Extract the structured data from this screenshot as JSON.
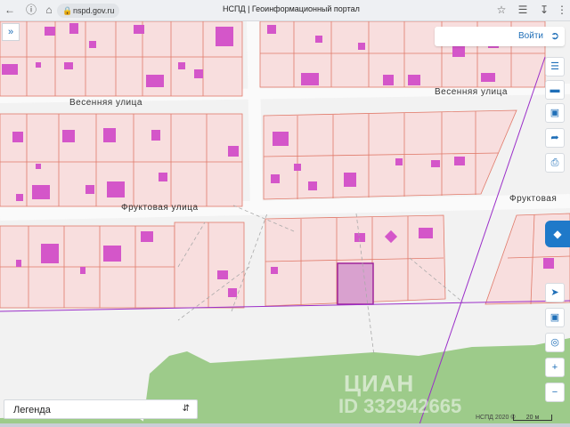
{
  "browser": {
    "url": "nspd.gov.ru",
    "page_title": "НСПД | Геоинформационный портал"
  },
  "map": {
    "streets": {
      "vesennyaya": "Весенняя улица",
      "fruktovaya_left": "Фруктовая улица",
      "fruktovaya_right": "Фруктовая"
    },
    "watermark": {
      "brand": "ЦИАН",
      "id_text": "ID 332942665"
    },
    "attribution": "НСПД 2020 ©",
    "scale_label": "20 м"
  },
  "controls": {
    "login_label": "Войти",
    "legend_label": "Легенда"
  },
  "colors": {
    "parcel_fill": "#f8dede",
    "parcel_stroke": "#e07a6a",
    "building_fill": "#d456c9",
    "selected_fill": "#d9a1cf",
    "forest": "#9dcb8a",
    "accent": "#1f79c9"
  },
  "icons": [
    "expand-icon",
    "layers-icon",
    "ruler-icon",
    "select-area-icon",
    "share-icon",
    "print-icon",
    "locate-icon",
    "geolocation-icon",
    "zoom-in-icon",
    "zoom-out-icon"
  ]
}
